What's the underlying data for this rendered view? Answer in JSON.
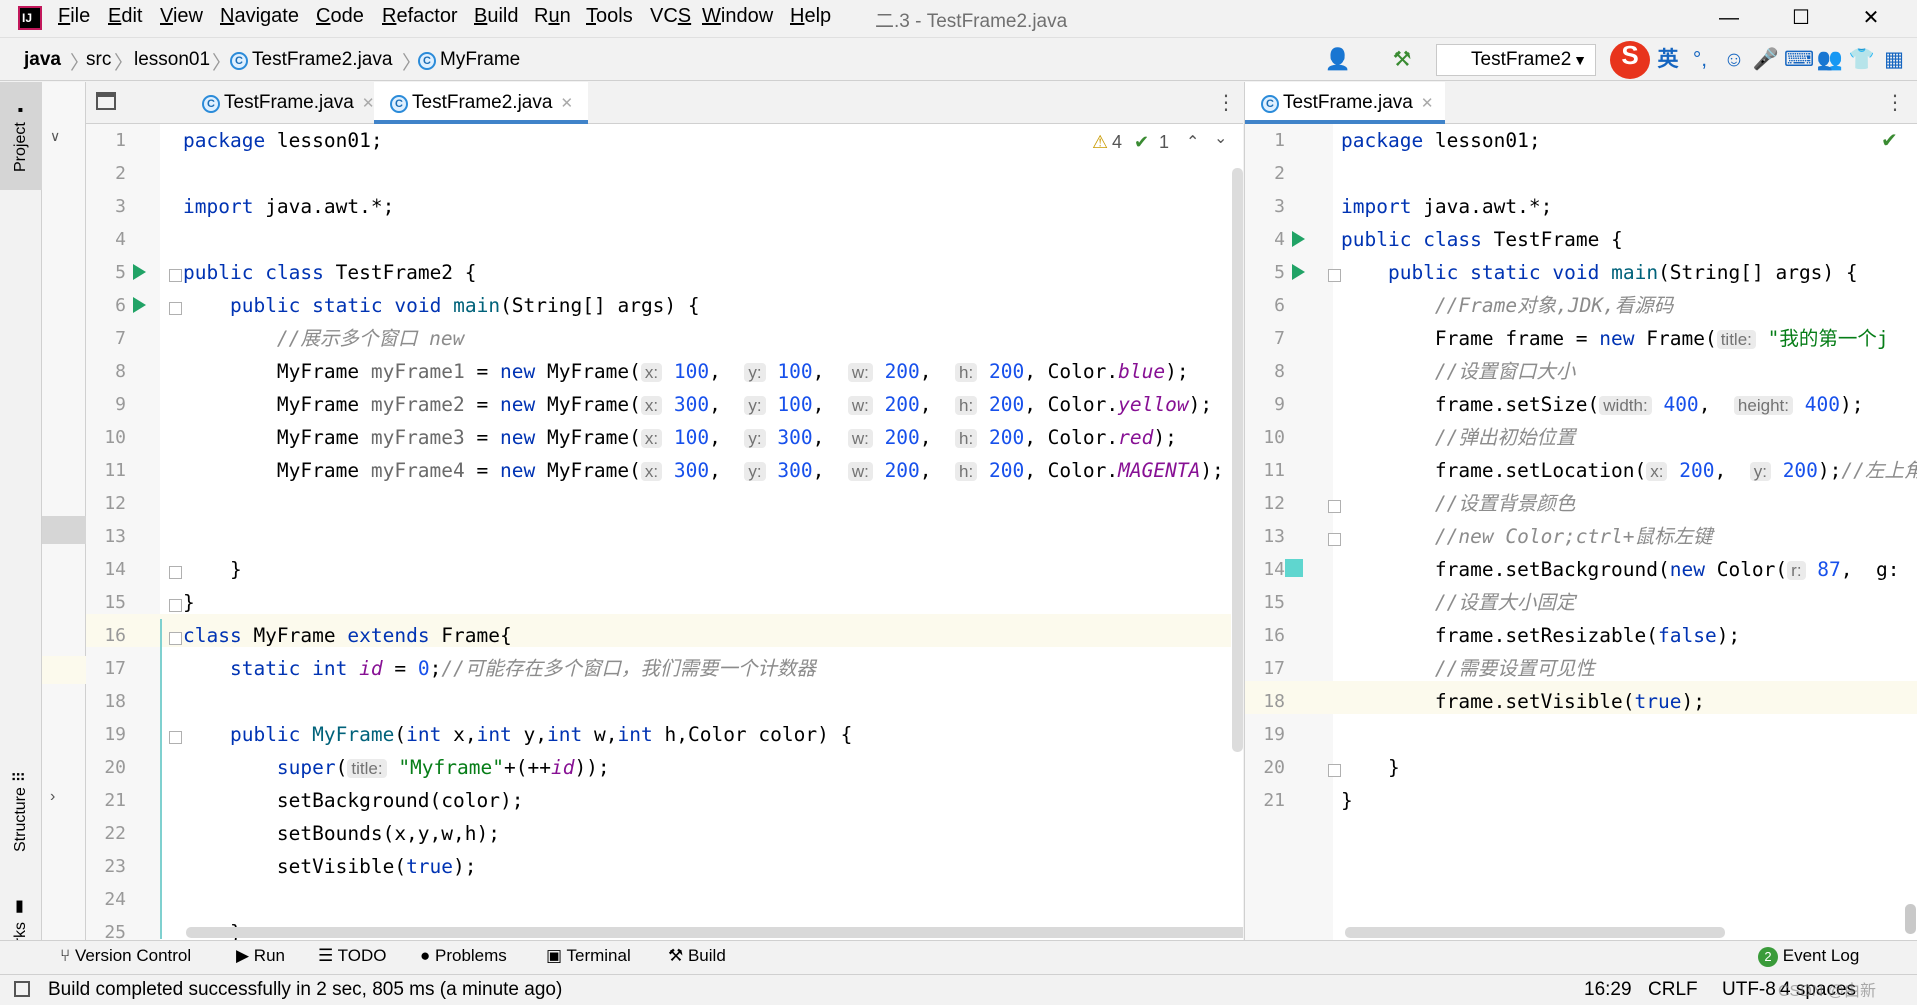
{
  "app": {
    "logo": "IJ",
    "window_title": "二.3 - TestFrame2.java",
    "menu": [
      {
        "label": "File",
        "ul": "F"
      },
      {
        "label": "Edit",
        "ul": "E"
      },
      {
        "label": "View",
        "ul": "V"
      },
      {
        "label": "Navigate",
        "ul": "N"
      },
      {
        "label": "Code",
        "ul": "C"
      },
      {
        "label": "Refactor",
        "ul": "R"
      },
      {
        "label": "Build",
        "ul": "B"
      },
      {
        "label": "Run",
        "ul": "u"
      },
      {
        "label": "Tools",
        "ul": "T"
      },
      {
        "label": "VCS",
        "ul": "S"
      },
      {
        "label": "Window",
        "ul": "W"
      },
      {
        "label": "Help",
        "ul": "H"
      }
    ]
  },
  "breadcrumb": [
    "java",
    "src",
    "lesson01",
    "TestFrame2.java",
    "MyFrame"
  ],
  "toolbar": {
    "run_config": "TestFrame2",
    "ime_label": "英"
  },
  "sidebar": {
    "project": "Project",
    "structure": "Structure",
    "bookmarks": "Bookmarks"
  },
  "left_editor": {
    "tabs": [
      {
        "label": "TestFrame.java",
        "active": false
      },
      {
        "label": "TestFrame2.java",
        "active": true
      }
    ],
    "warnings": "4",
    "weak_warnings": "1",
    "lines": [
      "package lesson01;",
      "",
      "import java.awt.*;",
      "",
      "public class TestFrame2 {",
      "    public static void main(String[] args) {",
      "        //展示多个窗口 new",
      "        MyFrame myFrame1 = new MyFrame( x: 100,  y: 100,  w: 200,  h: 200, Color.blue);",
      "        MyFrame myFrame2 = new MyFrame( x: 300,  y: 100,  w: 200,  h: 200, Color.yellow);",
      "        MyFrame myFrame3 = new MyFrame( x: 100,  y: 300,  w: 200,  h: 200, Color.red);",
      "        MyFrame myFrame4 = new MyFrame( x: 300,  y: 300,  w: 200,  h: 200, Color.MAGENTA);",
      "",
      "",
      "    }",
      "}",
      "class MyFrame extends Frame{",
      "    static int id = 0;//可能存在多个窗口，我们需要一个计数器",
      "",
      "    public MyFrame(int x,int y,int w,int h,Color color) {",
      "        super( title: \"Myframe\"+(++id));",
      "        setBackground(color);",
      "        setBounds(x,y,w,h);",
      "        setVisible(true);",
      "",
      "    }"
    ]
  },
  "right_editor": {
    "tabs": [
      {
        "label": "TestFrame.java",
        "active": true
      }
    ],
    "lines": [
      "package lesson01;",
      "",
      "import java.awt.*;",
      "public class TestFrame {",
      "    public static void main(String[] args) {",
      "        //Frame对象,JDK,看源码",
      "        Frame frame = new Frame( title: \"我的第一个j",
      "        //设置窗口大小",
      "        frame.setSize( width: 400, height: 400);",
      "        //弹出初始位置",
      "        frame.setLocation( x: 200, y: 200);//左上角",
      "        //设置背景颜色",
      "        //new Color;ctrl+鼠标左键",
      "        frame.setBackground(new Color( r: 87,  g:",
      "        //设置大小固定",
      "        frame.setResizable(false);",
      "        //需要设置可见性",
      "        frame.setVisible(true);",
      "",
      "    }",
      "}"
    ]
  },
  "tool_windows": [
    "Version Control",
    "Run",
    "TODO",
    "Problems",
    "Terminal",
    "Build",
    "Event Log"
  ],
  "event_log_count": "2",
  "status": {
    "message": "Build completed successfully in 2 sec, 805 ms (a minute ago)",
    "position": "16:29",
    "line_sep": "CRLF",
    "encoding": "UTF-8",
    "indent": "4 spaces",
    "watermark": "CSDN @由新"
  },
  "colors": {
    "accent": "#4083c9",
    "run_green": "#21a366",
    "warning": "#f0b400"
  }
}
